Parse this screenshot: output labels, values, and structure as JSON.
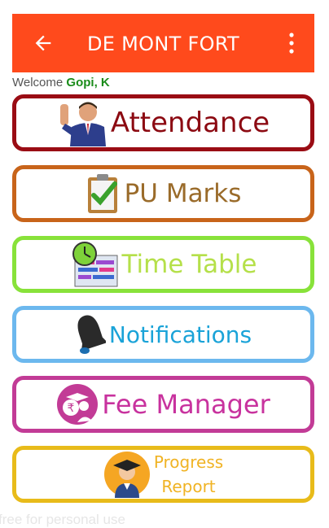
{
  "app_bar": {
    "title": "DE MONT FORT",
    "bg_color": "#ff4a1c",
    "back_icon": "arrow-left-icon",
    "menu_icon": "more-vert-icon"
  },
  "welcome": {
    "prefix": "Welcome ",
    "user": "Gopi, K"
  },
  "menu": [
    {
      "label": "Attendance",
      "icon": "person-raising-hand-icon",
      "border": "#9a0c14"
    },
    {
      "label": "PU Marks",
      "icon": "clipboard-check-icon",
      "border": "#c8641a"
    },
    {
      "label": "Time Table",
      "icon": "clock-schedule-icon",
      "border": "#88e23a"
    },
    {
      "label": "Notifications",
      "icon": "bell-icon",
      "border": "#6cb8ee"
    },
    {
      "label": "Fee Manager",
      "icon": "rupee-graduate-icon",
      "border": "#c23b96"
    },
    {
      "label_line1": "Progress",
      "label_line2": "Report",
      "icon": "graduate-avatar-icon",
      "border": "#e8bb1a"
    }
  ],
  "footer": {
    "text": "free for personal use"
  }
}
